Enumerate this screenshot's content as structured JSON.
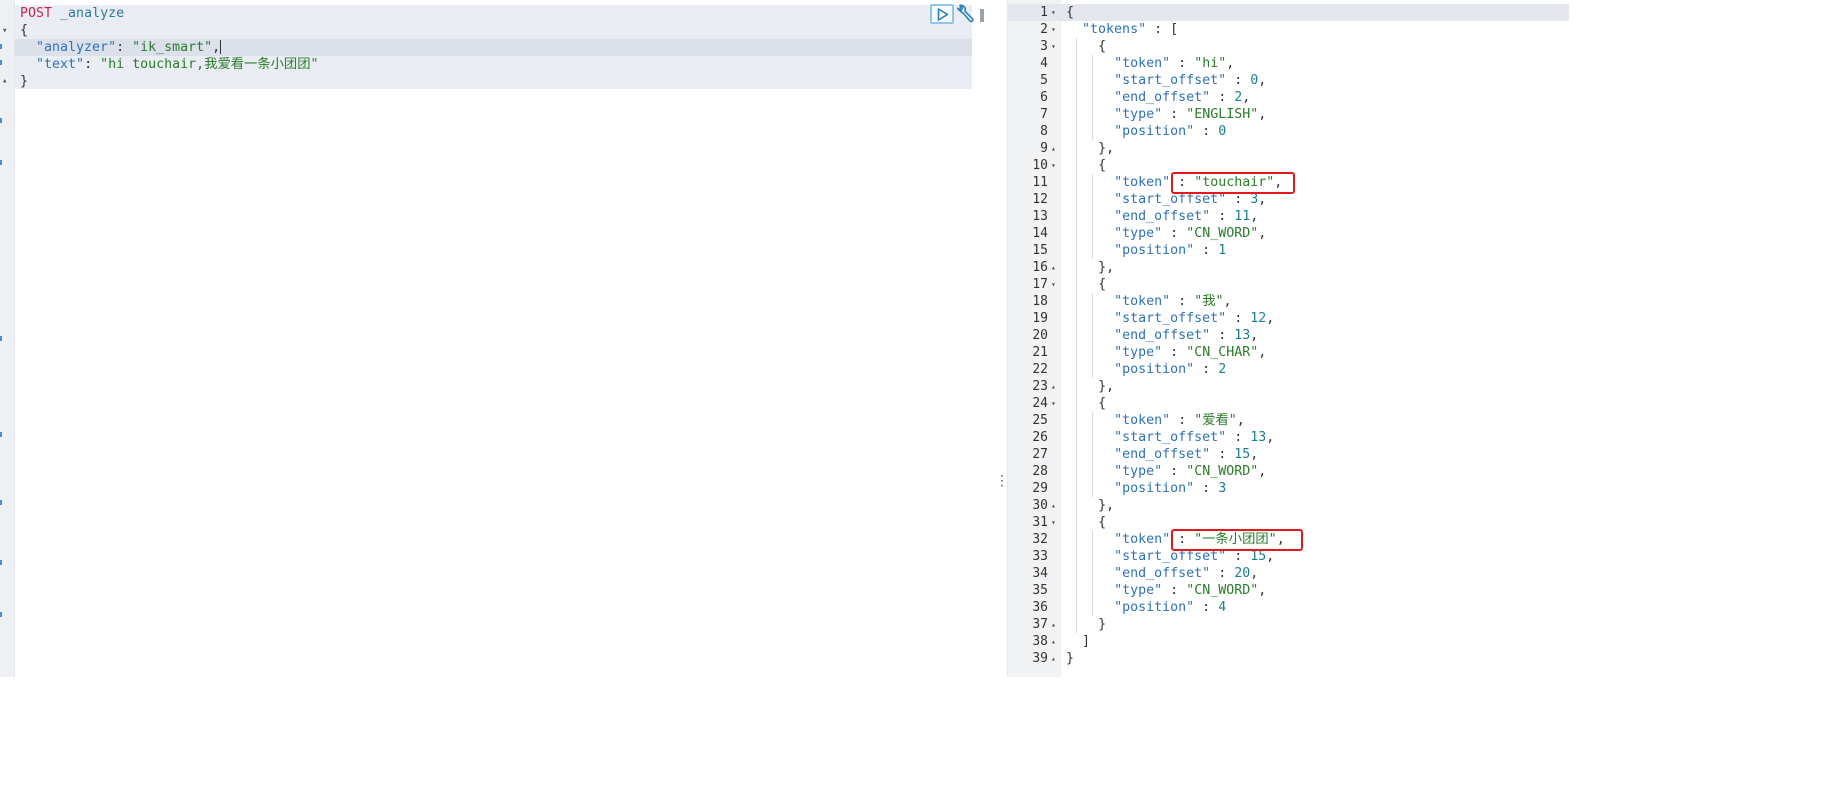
{
  "request": {
    "method": "POST",
    "path": "_analyze",
    "analyzer_key": "\"analyzer\"",
    "analyzer_value": "\"ik_smart\"",
    "text_key": "\"text\"",
    "text_value": "\"hi touchair,我爱看一条小团团\""
  },
  "toolbar": {
    "run_icon": "play-icon",
    "settings_icon": "wrench-icon",
    "accent_color": "#8ec5e8"
  },
  "response": {
    "tokens_key": "\"tokens\"",
    "tokens": [
      {
        "token": "\"hi\"",
        "start_offset": "0",
        "end_offset": "2",
        "type": "\"ENGLISH\"",
        "position": "0"
      },
      {
        "token": "\"touchair\"",
        "start_offset": "3",
        "end_offset": "11",
        "type": "\"CN_WORD\"",
        "position": "1"
      },
      {
        "token": "\"我\"",
        "start_offset": "12",
        "end_offset": "13",
        "type": "\"CN_CHAR\"",
        "position": "2"
      },
      {
        "token": "\"爱看\"",
        "start_offset": "13",
        "end_offset": "15",
        "type": "\"CN_WORD\"",
        "position": "3"
      },
      {
        "token": "\"一条小团团\"",
        "start_offset": "15",
        "end_offset": "20",
        "type": "\"CN_WORD\"",
        "position": "4"
      }
    ],
    "line_numbers": [
      "1",
      "2",
      "3",
      "4",
      "5",
      "6",
      "7",
      "8",
      "9",
      "10",
      "11",
      "12",
      "13",
      "14",
      "15",
      "16",
      "17",
      "18",
      "19",
      "20",
      "21",
      "22",
      "23",
      "24",
      "25",
      "26",
      "27",
      "28",
      "29",
      "30",
      "31",
      "32",
      "33",
      "34",
      "35",
      "36",
      "37",
      "38",
      "39"
    ],
    "highlight_color": "#e3191c"
  }
}
